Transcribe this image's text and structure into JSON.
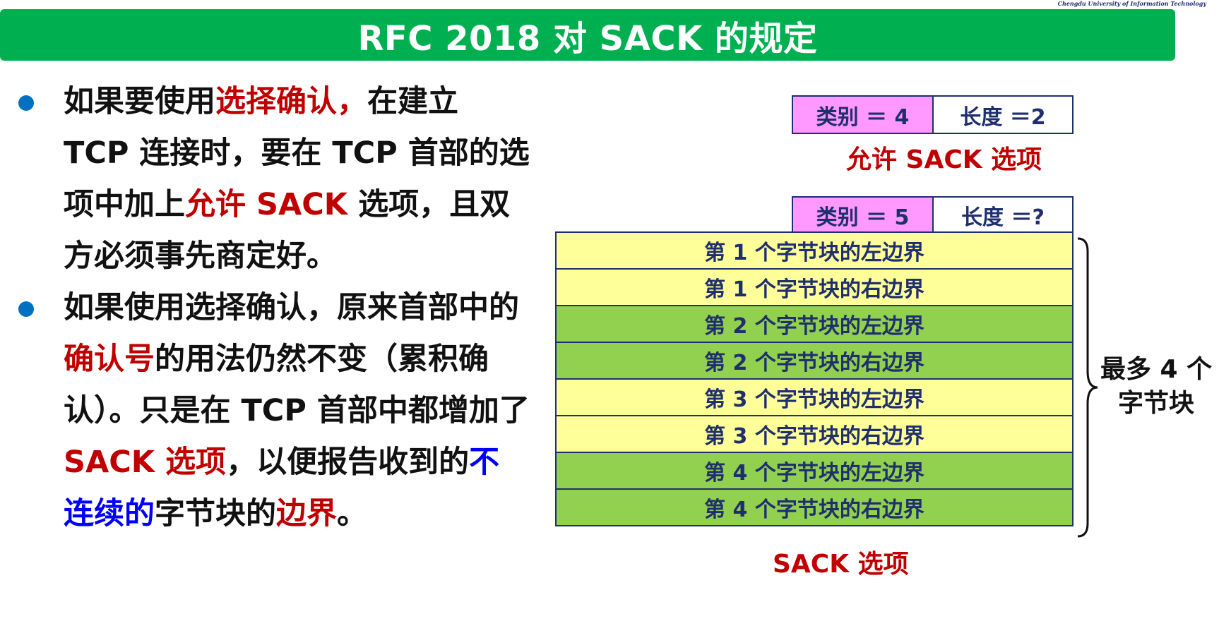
{
  "watermark": "Chengdu University of Information Technology",
  "title": "RFC 2018 对 SACK 的规定",
  "bullets": [
    {
      "segments": [
        {
          "text": "如果要使用",
          "color": "normal"
        },
        {
          "text": "选择确认，",
          "color": "red"
        },
        {
          "text": "在建立 TCP 连接时，要在 TCP 首部的选项中加上",
          "color": "normal"
        },
        {
          "text": "允许 SACK",
          "color": "red"
        },
        {
          "text": " 选项，且双方必须事先商定好。",
          "color": "normal"
        }
      ]
    },
    {
      "segments": [
        {
          "text": "如果使用选择确认，原来首部中的",
          "color": "normal"
        },
        {
          "text": "确认号",
          "color": "red"
        },
        {
          "text": "的用法仍然不变（累积确认）。只是在 TCP 首部中都增加了 ",
          "color": "normal"
        },
        {
          "text": "SACK 选项",
          "color": "red"
        },
        {
          "text": "，以便报告收到的",
          "color": "normal"
        },
        {
          "text": "不连续的",
          "color": "blue"
        },
        {
          "text": "字节块的",
          "color": "normal"
        },
        {
          "text": "边界",
          "color": "red"
        },
        {
          "text": "。",
          "color": "normal"
        }
      ]
    }
  ],
  "sack_permitted": {
    "kind_label": "类别 ＝ 4",
    "length_label": "长度 ＝2",
    "caption": "允许 SACK 选项"
  },
  "sack_option": {
    "kind_label": "类别 ＝ 5",
    "length_label": "长度 ＝?",
    "blocks": [
      {
        "label": "第 1 个字节块的左边界",
        "fill": "yellow"
      },
      {
        "label": "第 1 个字节块的右边界",
        "fill": "yellow"
      },
      {
        "label": "第 2 个字节块的左边界",
        "fill": "green"
      },
      {
        "label": "第 2 个字节块的右边界",
        "fill": "green"
      },
      {
        "label": "第 3 个字节块的左边界",
        "fill": "yellow"
      },
      {
        "label": "第 3 个字节块的右边界",
        "fill": "yellow"
      },
      {
        "label": "第 4 个字节块的左边界",
        "fill": "green"
      },
      {
        "label": "第 4 个字节块的右边界",
        "fill": "green"
      }
    ],
    "brace_label": "最多 4 个字节块",
    "caption": "SACK 选项"
  },
  "colors": {
    "title_bar": "#00b050",
    "bullet_dot": "#0070c0",
    "red_text": "#c00000",
    "blue_text": "#0000ff",
    "pink_cell": "#ff99ff",
    "yellow_row": "#ffff99",
    "green_row": "#92d050",
    "border": "#1f2f6e"
  }
}
